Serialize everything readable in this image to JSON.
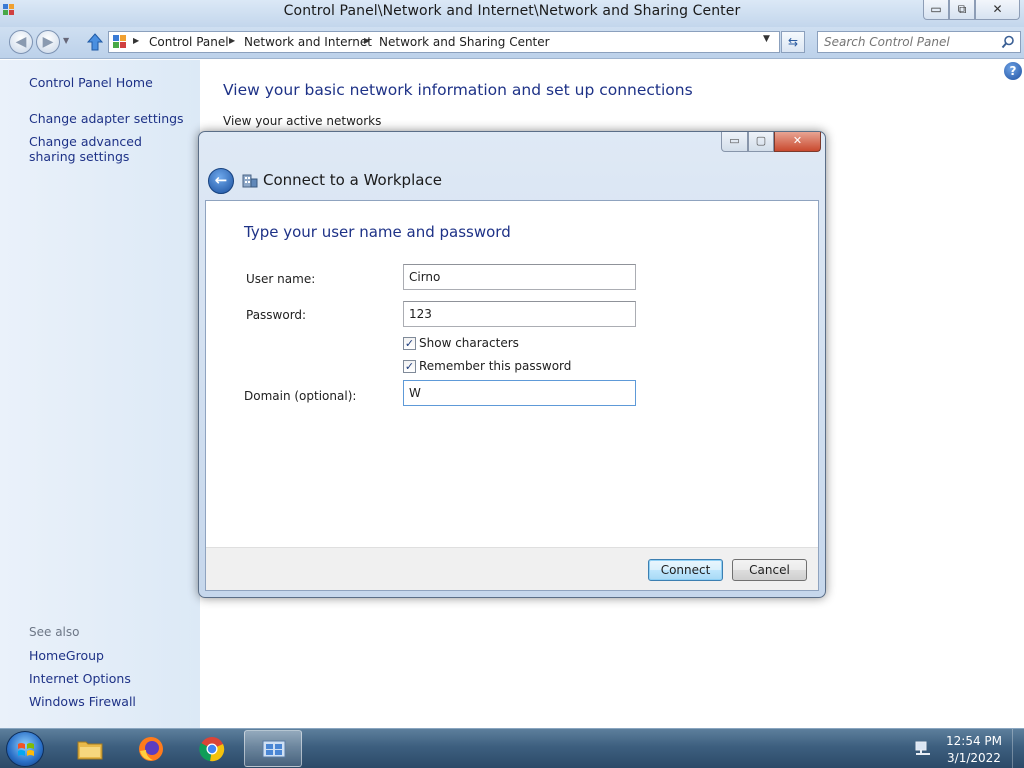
{
  "window": {
    "title": "Control Panel\\Network and Internet\\Network and Sharing Center",
    "minimize": "▭",
    "maximize": "⧉",
    "close": "✕"
  },
  "address": {
    "crumbs": [
      "Control Panel",
      "Network and Internet",
      "Network and Sharing Center"
    ],
    "search_placeholder": "Search Control Panel"
  },
  "sidebar": {
    "home": "Control Panel Home",
    "links": [
      "Change adapter settings",
      "Change advanced sharing settings"
    ],
    "see_also_heading": "See also",
    "see_also": [
      "HomeGroup",
      "Internet Options",
      "Windows Firewall"
    ]
  },
  "main": {
    "title": "View your basic network information and set up connections",
    "subtitle": "View your active networks",
    "help": "?"
  },
  "dialog": {
    "title": "Connect to a Workplace",
    "heading": "Type your user name and password",
    "username_label": "User name:",
    "username_value": "Cirno",
    "password_label": "Password:",
    "password_value": "123",
    "show_characters_label": "Show characters",
    "show_characters_checked": true,
    "remember_label": "Remember this password",
    "remember_checked": true,
    "domain_label": "Domain (optional):",
    "domain_value": "W",
    "connect_label": "Connect",
    "cancel_label": "Cancel",
    "min": "▭",
    "max": "▢",
    "close": "✕"
  },
  "taskbar": {
    "apps": [
      "folder-icon",
      "firefox-icon",
      "chrome-icon",
      "network-center-icon"
    ],
    "time": "12:54 PM",
    "date": "3/1/2022"
  },
  "colors": {
    "link": "#1e3287",
    "accent": "#3c7fb1"
  }
}
